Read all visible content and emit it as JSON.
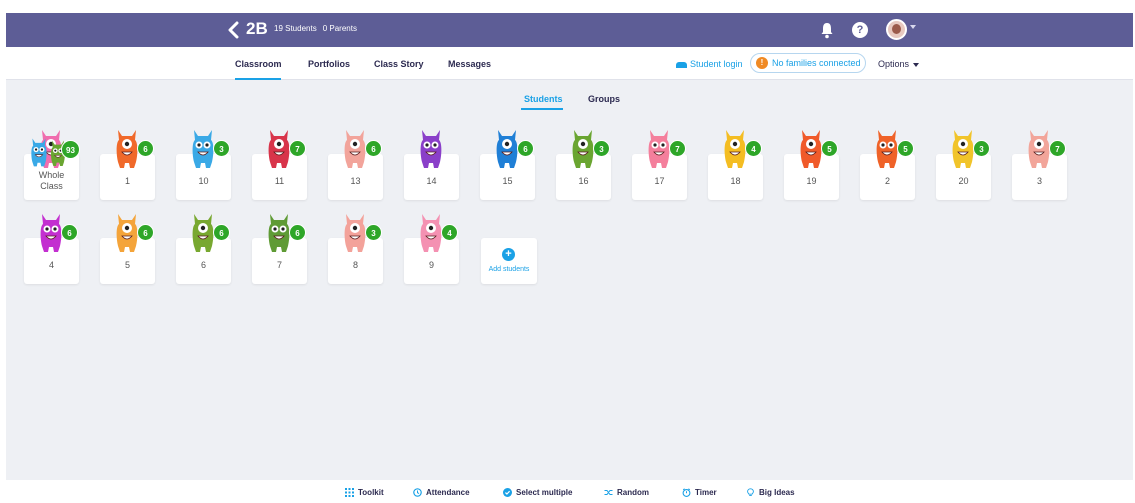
{
  "header": {
    "class_name": "2B",
    "student_count": "19 Students",
    "parent_count": "0 Parents",
    "help_label": "?"
  },
  "nav": {
    "tabs": [
      {
        "label": "Classroom",
        "active": true
      },
      {
        "label": "Portfolios",
        "active": false
      },
      {
        "label": "Class Story",
        "active": false
      },
      {
        "label": "Messages",
        "active": false
      }
    ],
    "student_login": "Student login",
    "families": {
      "label": "No families connected",
      "icon": "!"
    },
    "options": "Options"
  },
  "subtabs": [
    {
      "label": "Students",
      "active": true
    },
    {
      "label": "Groups",
      "active": false
    }
  ],
  "students": [
    {
      "name": "Whole Class",
      "points": "93",
      "color": "#f06dae",
      "kind": "group"
    },
    {
      "name": "1",
      "points": "6",
      "color": "#f0692a",
      "kind": "one"
    },
    {
      "name": "10",
      "points": "3",
      "color": "#3aa9e6",
      "kind": "one"
    },
    {
      "name": "11",
      "points": "7",
      "color": "#d8344a",
      "kind": "one"
    },
    {
      "name": "13",
      "points": "6",
      "color": "#f2a49b",
      "kind": "one"
    },
    {
      "name": "14",
      "points": "",
      "color": "#8a3fc9",
      "kind": "one"
    },
    {
      "name": "15",
      "points": "6",
      "color": "#1f7fd6",
      "kind": "one"
    },
    {
      "name": "16",
      "points": "3",
      "color": "#6aa531",
      "kind": "one"
    },
    {
      "name": "17",
      "points": "7",
      "color": "#f47f9c",
      "kind": "one"
    },
    {
      "name": "18",
      "points": "4",
      "color": "#f4bd22",
      "kind": "one"
    },
    {
      "name": "19",
      "points": "5",
      "color": "#f05a2a",
      "kind": "one"
    },
    {
      "name": "2",
      "points": "5",
      "color": "#ef6228",
      "kind": "one"
    },
    {
      "name": "20",
      "points": "3",
      "color": "#f1c42a",
      "kind": "one"
    },
    {
      "name": "3",
      "points": "7",
      "color": "#f2a59a",
      "kind": "one"
    },
    {
      "name": "4",
      "points": "6",
      "color": "#c32fd0",
      "kind": "one"
    },
    {
      "name": "5",
      "points": "6",
      "color": "#f4a43a",
      "kind": "one"
    },
    {
      "name": "6",
      "points": "6",
      "color": "#78a830",
      "kind": "one"
    },
    {
      "name": "7",
      "points": "6",
      "color": "#5f9b35",
      "kind": "one"
    },
    {
      "name": "8",
      "points": "3",
      "color": "#f3a29a",
      "kind": "one"
    },
    {
      "name": "9",
      "points": "4",
      "color": "#f491b2",
      "kind": "one"
    }
  ],
  "add_students": {
    "label": "Add students",
    "icon": "+"
  },
  "toolbar": [
    {
      "label": "Toolkit",
      "icon": "grid-icon"
    },
    {
      "label": "Attendance",
      "icon": "clock-icon"
    },
    {
      "label": "Select multiple",
      "icon": "check-icon"
    },
    {
      "label": "Random",
      "icon": "shuffle-icon"
    },
    {
      "label": "Timer",
      "icon": "timer-icon"
    },
    {
      "label": "Big Ideas",
      "icon": "lightbulb-icon"
    }
  ],
  "colors": {
    "header_bg": "#5d5d96",
    "accent": "#1aa1e6",
    "points_badge": "#2ea628",
    "warning": "#f08a24",
    "app_bg": "#eef0f4"
  }
}
